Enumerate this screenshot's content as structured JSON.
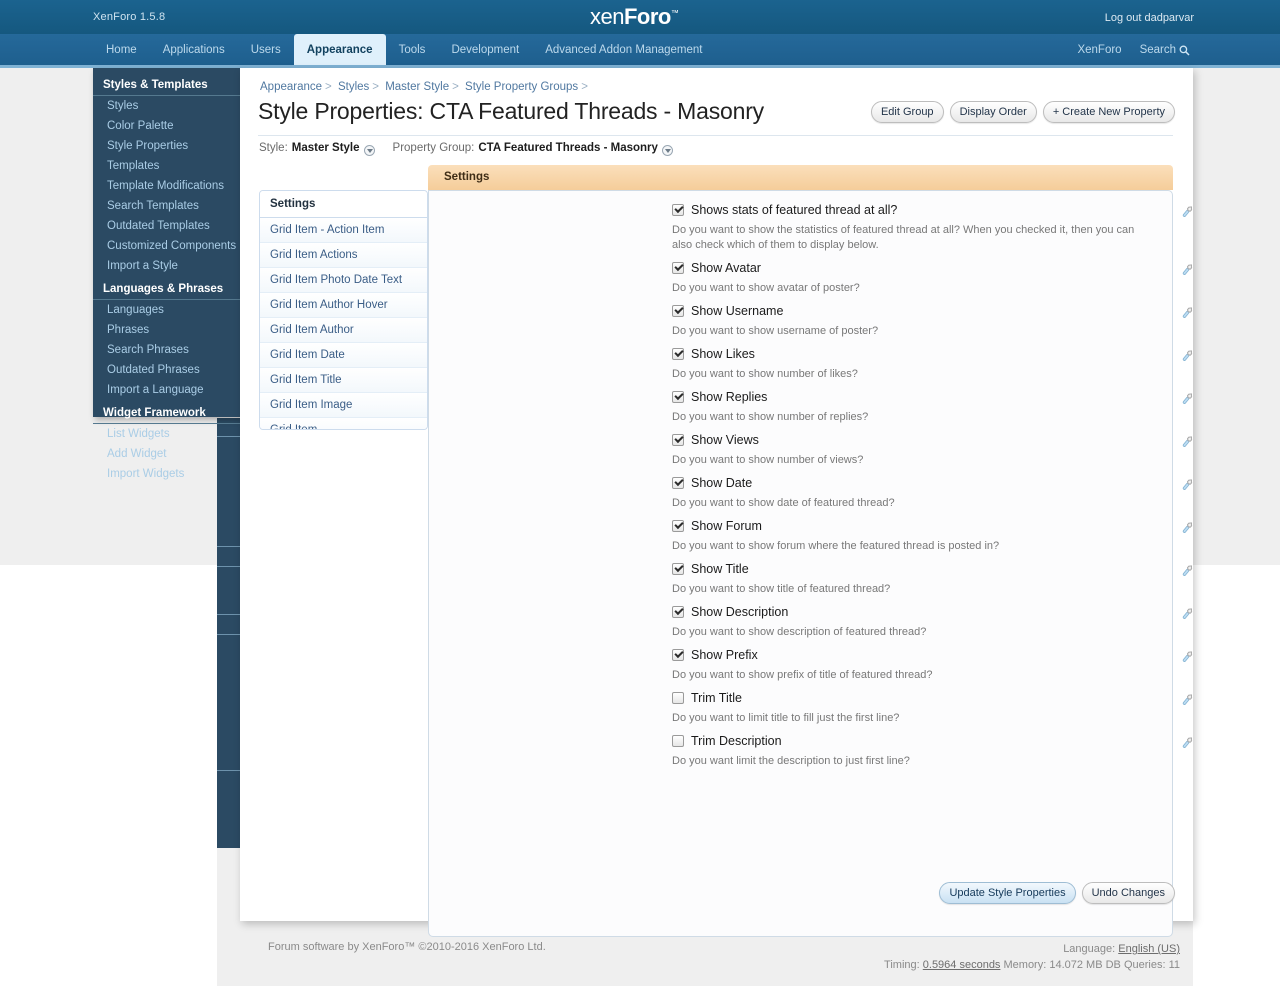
{
  "topbar": {
    "version": "XenForo 1.5.8",
    "logo_pre": "xen",
    "logo_post": "Foro",
    "logo_tm": "™",
    "logout": "Log out dadparvar"
  },
  "nav": {
    "tabs": [
      {
        "label": "Home",
        "active": false
      },
      {
        "label": "Applications",
        "active": false
      },
      {
        "label": "Users",
        "active": false
      },
      {
        "label": "Appearance",
        "active": true
      },
      {
        "label": "Tools",
        "active": false
      },
      {
        "label": "Development",
        "active": false
      },
      {
        "label": "Advanced Addon Management",
        "active": false
      }
    ],
    "right": [
      {
        "label": "XenForo"
      },
      {
        "label": "Search"
      }
    ]
  },
  "sidenav": {
    "groups": [
      {
        "title": "Styles & Templates",
        "items": [
          "Styles",
          "Color Palette",
          "Style Properties",
          "Templates",
          "Template Modifications",
          "Search Templates",
          "Outdated Templates",
          "Customized Components",
          "Import a Style"
        ]
      },
      {
        "title": "Languages & Phrases",
        "items": [
          "Languages",
          "Phrases",
          "Search Phrases",
          "Outdated Phrases",
          "Import a Language"
        ]
      },
      {
        "title": "Widget Framework",
        "items": [
          "List Widgets",
          "Add Widget",
          "Import Widgets"
        ]
      }
    ]
  },
  "breadcrumb": [
    "Appearance",
    "Styles",
    "Master Style",
    "Style Property Groups"
  ],
  "page": {
    "title": "Style Properties: CTA Featured Threads - Masonry",
    "style_label": "Style:",
    "style_value": "Master Style",
    "group_label": "Property Group:",
    "group_value": "CTA Featured Threads - Masonry"
  },
  "toolbar": {
    "edit_group": "Edit Group",
    "display_order": "Display Order",
    "create_new_property": "+ Create New Property"
  },
  "tabstrip": {
    "settings": "Settings"
  },
  "side_panel": {
    "header": "Settings",
    "items": [
      "Grid Item - Action Item",
      "Grid Item Actions",
      "Grid Item Photo Date Text",
      "Grid Item Author Hover",
      "Grid Item Author",
      "Grid Item Date",
      "Grid Item Title",
      "Grid Item Image",
      "Grid Item"
    ]
  },
  "properties": [
    {
      "label": "Shows stats of featured thread at all?",
      "checked": true,
      "desc": "Do you want to show the statistics of featured thread at all? When you checked it, then you can also check which of them to display below."
    },
    {
      "label": "Show Avatar",
      "checked": true,
      "desc": "Do you want to show avatar of poster?"
    },
    {
      "label": "Show Username",
      "checked": true,
      "desc": "Do you want to show username of poster?"
    },
    {
      "label": "Show Likes",
      "checked": true,
      "desc": "Do you want to show number of likes?"
    },
    {
      "label": "Show Replies",
      "checked": true,
      "desc": "Do you want to show number of replies?"
    },
    {
      "label": "Show Views",
      "checked": true,
      "desc": "Do you want to show number of views?"
    },
    {
      "label": "Show Date",
      "checked": true,
      "desc": "Do you want to show date of featured thread?"
    },
    {
      "label": "Show Forum",
      "checked": true,
      "desc": "Do you want to show forum where the featured thread is posted in?"
    },
    {
      "label": "Show Title",
      "checked": true,
      "desc": "Do you want to show title of featured thread?"
    },
    {
      "label": "Show Description",
      "checked": true,
      "desc": "Do you want to show description of featured thread?"
    },
    {
      "label": "Show Prefix",
      "checked": true,
      "desc": "Do you want to show prefix of title of featured thread?"
    },
    {
      "label": "Trim Title",
      "checked": false,
      "desc": "Do you want to limit title to fill just the first line?"
    },
    {
      "label": "Trim Description",
      "checked": false,
      "desc": "Do you want limit the description to just first line?"
    }
  ],
  "bottom_buttons": {
    "update": "Update Style Properties",
    "undo": "Undo Changes"
  },
  "footer": {
    "copyright": "Forum software by XenForo™ ©2010-2016 XenForo Ltd.",
    "language_label": "Language:",
    "language_value": "English (US)",
    "timing_label": "Timing:",
    "timing_value": "0.5964 seconds",
    "memory": "Memory: 14.072 MB",
    "queries": "DB Queries: 11"
  },
  "colors": {
    "header_blue": "#175d8d",
    "nav_blue": "#25699a",
    "sidenav_navy": "#2b4a63",
    "tab_orange": "#f5cd9a",
    "link_blue": "#5078a0"
  }
}
